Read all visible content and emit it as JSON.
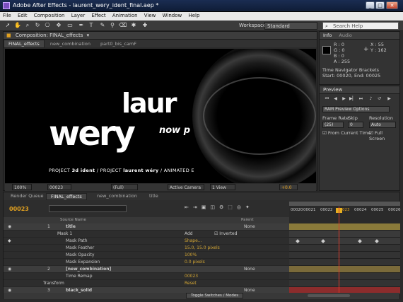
{
  "window": {
    "title": "Adobe After Effects - laurent_wery_ident_final.aep *",
    "controls": [
      "_",
      "□",
      "✕"
    ]
  },
  "menu": [
    "File",
    "Edit",
    "Composition",
    "Layer",
    "Effect",
    "Animation",
    "View",
    "Window",
    "Help"
  ],
  "toolbar": {
    "workspace_label": "Workspace:",
    "workspace_value": "Standard",
    "search_placeholder": "Search Help"
  },
  "comp": {
    "panel_title": "Composition: FINAL_effects",
    "tabs": [
      "FINAL_effects",
      "new_combination",
      "part0_bis_camF"
    ],
    "viewer": {
      "line1": "laur",
      "line2": "wery",
      "now": "now p",
      "caption_pre": "PROJECT ",
      "caption_bold1": "3d ident",
      "caption_mid": " / PROJECT ",
      "caption_bold2": "laurent wéry",
      "caption_post": " / ANIMATED E"
    },
    "footer": {
      "zoom": "100%",
      "timecode": "00023",
      "resolution": "(Full)",
      "camera": "Active Camera",
      "views": "1 View",
      "exposure": "+0.0"
    }
  },
  "info": {
    "tabs": [
      "Info",
      "Audio"
    ],
    "r": "R : 0",
    "g": "G : 0",
    "b": "B : 0",
    "a": "A : 255",
    "x": "X : 55",
    "y": "Y : 162",
    "line1": "Time Navigator Brackets",
    "line2": "Start: 00020, End: 00025"
  },
  "preview": {
    "title": "Preview",
    "ram": "RAM Preview Options",
    "frame_rate_label": "Frame Rate",
    "skip_label": "Skip",
    "resolution_label": "Resolution",
    "frame_rate": "(25)",
    "skip": "0",
    "resolution": "Auto",
    "from_current": "From Current Time",
    "full_screen": "Full Screen"
  },
  "timeline": {
    "tabs": [
      "Render Queue",
      "FINAL_effects",
      "new_combination",
      "title"
    ],
    "timecode": "00023",
    "ruler": [
      "00020",
      "00021",
      "00022",
      "00023",
      "00024",
      "00025",
      "00026"
    ],
    "col_source": "Source Name",
    "col_parent": "Parent",
    "rows": [
      {
        "num": "1",
        "name": "title",
        "parent": "None",
        "layer": true
      },
      {
        "num": "",
        "name": "Mask 1",
        "val": "Add",
        "extra": "Inverted"
      },
      {
        "num": "",
        "name": "Mask Path",
        "val": "Shape..."
      },
      {
        "num": "",
        "name": "Mask Feather",
        "val": "15.0, 15.0 pixels"
      },
      {
        "num": "",
        "name": "Mask Opacity",
        "val": "100%"
      },
      {
        "num": "",
        "name": "Mask Expansion",
        "val": "0.0 pixels"
      },
      {
        "num": "2",
        "name": "[new_combination]",
        "parent": "None",
        "layer": true
      },
      {
        "num": "",
        "name": "Time Remap",
        "val": "00023"
      },
      {
        "num": "",
        "name": "Transform",
        "val": "Reset"
      },
      {
        "num": "3",
        "name": "black_solid",
        "parent": "None",
        "layer": true
      }
    ],
    "toggle_label": "Toggle Switches / Modes"
  },
  "colors": {
    "accent": "#e0a020",
    "playhead": "#d83a2a",
    "title_bar": "#1a2d52"
  }
}
